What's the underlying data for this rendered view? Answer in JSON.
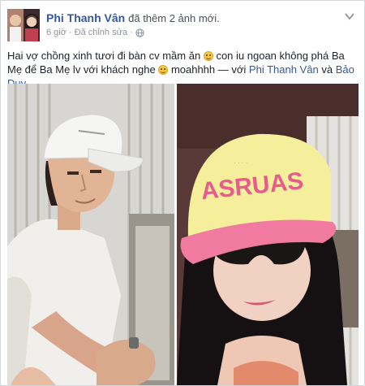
{
  "post": {
    "author": "Phi Thanh Vân",
    "action": "đã thêm 2 ảnh mới.",
    "time": "6 giờ",
    "separator": "·",
    "edited": "Đã chỉnh sửa",
    "separator2": "·",
    "text_1": "Hai vợ chồng xinh tươi đi bàn cv mầm ăn",
    "text_2": "con iu ngoan không phá Ba Mẹ để Ba Mẹ lv với khách nghe",
    "text_3": "moahhhh — với",
    "tag_1": "Phi Thanh Vân",
    "and": "và",
    "tag_2": "Bảo Duy",
    "period": "."
  },
  "photos": {
    "cap_text": "ASRUAS"
  },
  "icons": {
    "avatar": "profile-avatar",
    "privacy": "globe-icon",
    "menu": "chevron-down-icon",
    "emoji": "smiley-emoji"
  }
}
